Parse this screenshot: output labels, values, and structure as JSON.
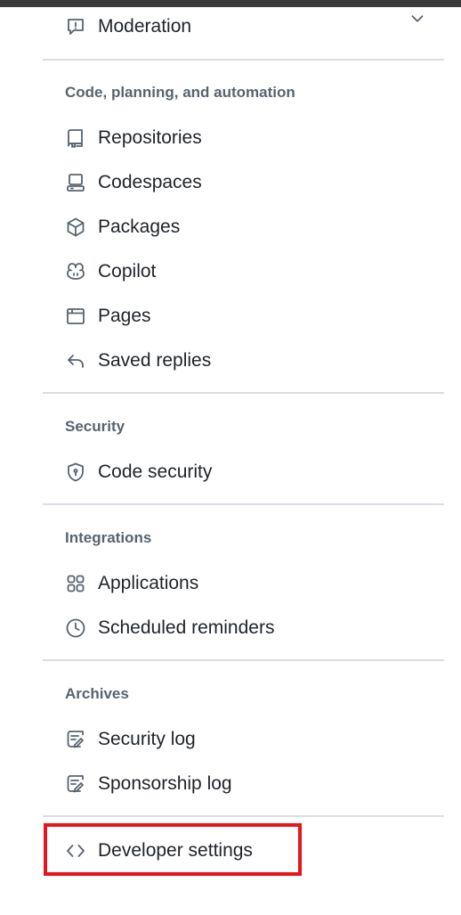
{
  "moderation": {
    "label": "Moderation",
    "icon": "report-icon",
    "expand_icon": "chevron-down-icon"
  },
  "sections": [
    {
      "heading": "Code, planning, and automation",
      "items": [
        {
          "label": "Repositories",
          "icon": "repo-icon"
        },
        {
          "label": "Codespaces",
          "icon": "codespaces-icon"
        },
        {
          "label": "Packages",
          "icon": "package-icon"
        },
        {
          "label": "Copilot",
          "icon": "copilot-icon"
        },
        {
          "label": "Pages",
          "icon": "browser-icon"
        },
        {
          "label": "Saved replies",
          "icon": "reply-icon"
        }
      ]
    },
    {
      "heading": "Security",
      "items": [
        {
          "label": "Code security",
          "icon": "shield-lock-icon"
        }
      ]
    },
    {
      "heading": "Integrations",
      "items": [
        {
          "label": "Applications",
          "icon": "apps-icon"
        },
        {
          "label": "Scheduled reminders",
          "icon": "clock-icon"
        }
      ]
    },
    {
      "heading": "Archives",
      "items": [
        {
          "label": "Security log",
          "icon": "log-icon"
        },
        {
          "label": "Sponsorship log",
          "icon": "log-icon"
        }
      ]
    }
  ],
  "developer": {
    "label": "Developer settings",
    "icon": "code-icon"
  },
  "colors": {
    "highlight": "#e8141c",
    "icon": "#59636e",
    "text": "#1f2328",
    "divider": "#d8dee4"
  }
}
